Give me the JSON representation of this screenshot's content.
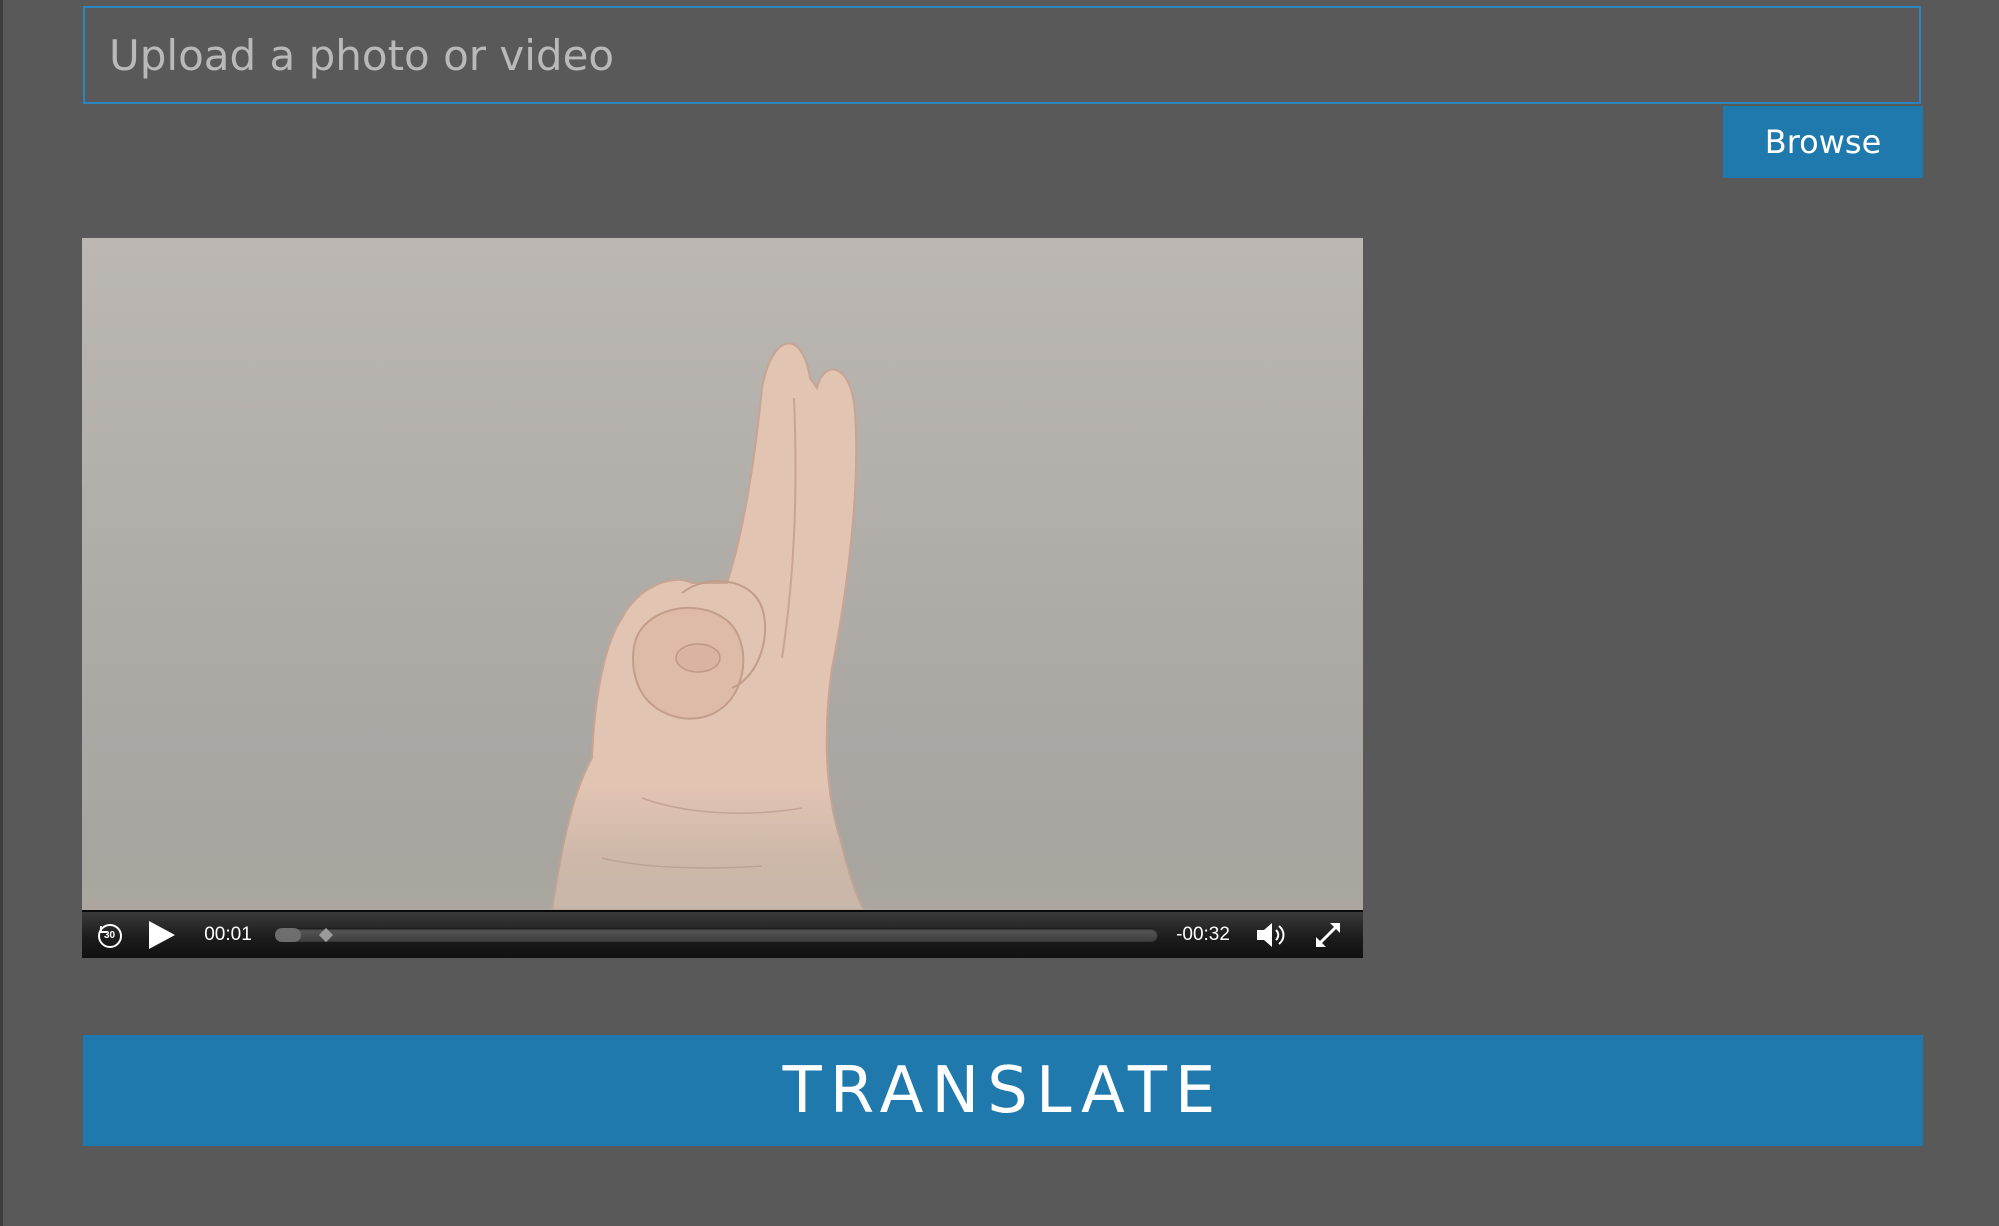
{
  "upload": {
    "placeholder": "Upload a photo or video",
    "browse_label": "Browse"
  },
  "video": {
    "rewind_label": "30",
    "current_time": "00:01",
    "remaining_time": "-00:32",
    "progress_fraction": 0.03
  },
  "actions": {
    "translate_label": "TRANSLATE"
  },
  "colors": {
    "accent": "#2079ad",
    "field_border": "#2a86c0",
    "background": "#595959"
  }
}
